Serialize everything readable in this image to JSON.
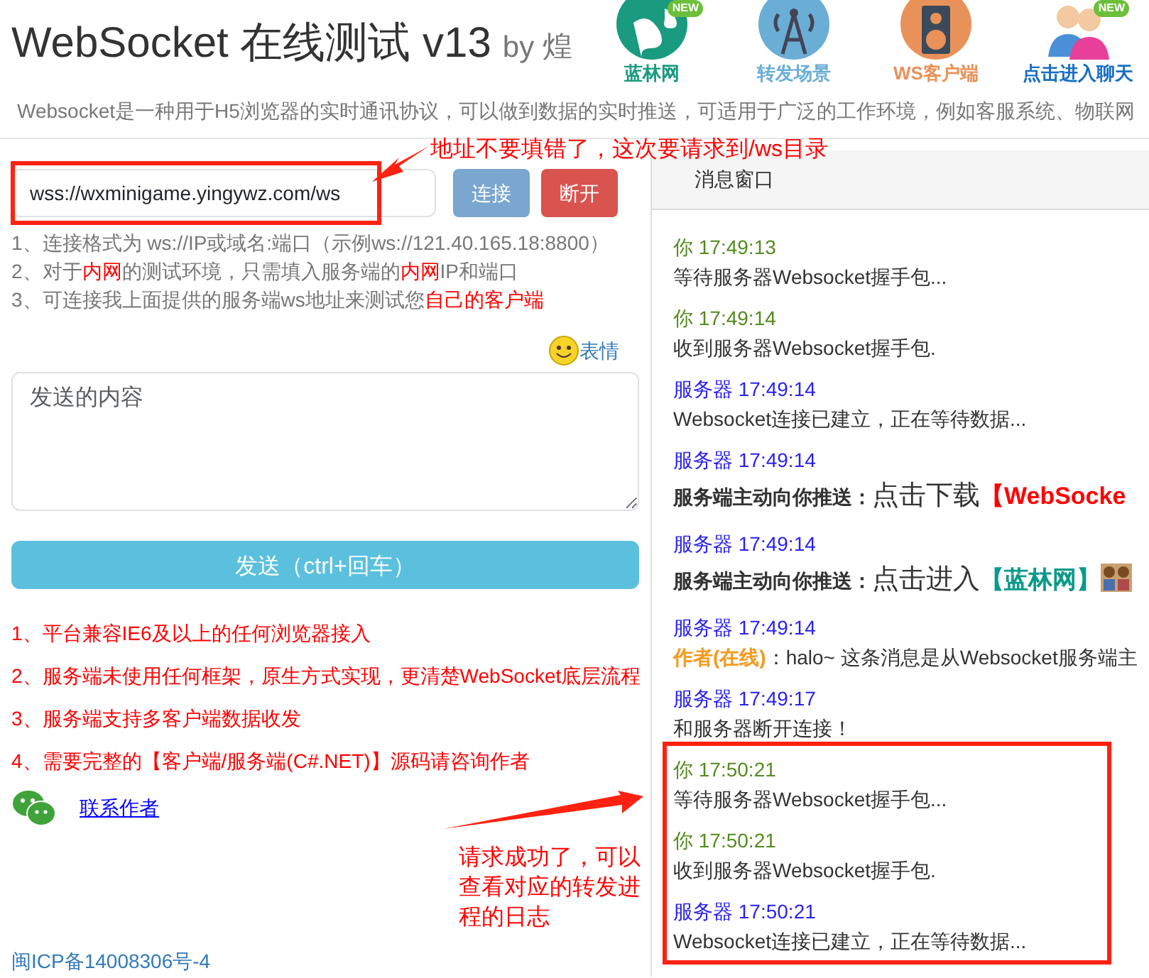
{
  "header": {
    "title": "WebSocket 在线测试 v13",
    "byline": "by 煌",
    "nav": [
      {
        "label": "蓝林网",
        "kind": "globe",
        "color": "#1a9a7f",
        "badge": "NEW"
      },
      {
        "label": "转发场景",
        "kind": "antenna",
        "color": "#6aaed6"
      },
      {
        "label": "WS客户端",
        "kind": "speaker",
        "color": "#e8925a"
      },
      {
        "label": "点击进入聊天",
        "kind": "people",
        "color": "#1a6fc2",
        "badge": "NEW"
      }
    ],
    "description": "Websocket是一种用于H5浏览器的实时通讯协议，可以做到数据的实时推送，可适用于广泛的工作环境，例如客服系统、物联网"
  },
  "connection": {
    "address": "wss://wxminigame.yingywz.com/ws",
    "buttons": [
      {
        "label": "连接",
        "kind": "connect"
      },
      {
        "label": "断开",
        "kind": "disconnect"
      }
    ]
  },
  "hints": [
    [
      {
        "text": "1、连接格式为 ws://IP或域名:端口（示例ws://121.40.165.18:8800）",
        "red": false
      }
    ],
    [
      {
        "text": "2、对于",
        "red": false
      },
      {
        "text": "内网",
        "red": true
      },
      {
        "text": "的测试环境，只需填入服务端的",
        "red": false
      },
      {
        "text": "内网",
        "red": true
      },
      {
        "text": "IP和端口",
        "red": false
      }
    ],
    [
      {
        "text": "3、可连接我上面提供的服务端ws地址来测试您",
        "red": false
      },
      {
        "text": "自己的客户端",
        "red": true
      }
    ]
  ],
  "emoji_link": "表情",
  "message_input": {
    "placeholder": "发送的内容"
  },
  "send_button": "发送（ctrl+回车）",
  "features": [
    "1、平台兼容IE6及以上的任何浏览器接入",
    "2、服务端未使用任何框架，原生方式实现，更清楚WebSocket底层流程",
    "3、服务端支持多客户端数据收发",
    "4、需要完整的【客户端/服务端(C#.NET)】源码请咨询作者"
  ],
  "contact_link": "联系作者",
  "footer": "闽ICP备14008306号-4",
  "message_panel": {
    "title": "消息窗口",
    "messages": [
      {
        "sender": "你",
        "kind": "you",
        "time": "17:49:13",
        "body": [
          {
            "kind": "plain",
            "text": "等待服务器Websocket握手包..."
          }
        ]
      },
      {
        "sender": "你",
        "kind": "you",
        "time": "17:49:14",
        "body": [
          {
            "kind": "plain",
            "text": "收到服务器Websocket握手包."
          }
        ]
      },
      {
        "sender": "服务器",
        "kind": "server",
        "time": "17:49:14",
        "body": [
          {
            "kind": "plain",
            "text": "Websocket连接已建立，正在等待数据..."
          }
        ]
      },
      {
        "sender": "服务器",
        "kind": "server",
        "time": "17:49:14",
        "body": [
          {
            "kind": "bold",
            "text": "服务端主动向你推送："
          },
          {
            "kind": "large",
            "text": "点击下载"
          },
          {
            "kind": "red-bold",
            "text": "【WebSocke"
          }
        ]
      },
      {
        "sender": "服务器",
        "kind": "server",
        "time": "17:49:14",
        "body": [
          {
            "kind": "bold",
            "text": "服务端主动向你推送："
          },
          {
            "kind": "large",
            "text": "点击进入"
          },
          {
            "kind": "teal-bold",
            "text": "【蓝林网】"
          },
          {
            "kind": "picture"
          }
        ]
      },
      {
        "sender": "服务器",
        "kind": "server",
        "time": "17:49:14",
        "body": [
          {
            "kind": "orange-bold",
            "text": "作者(在线)"
          },
          {
            "kind": "plain",
            "text": "：halo~ 这条消息是从Websocket服务端主"
          }
        ]
      },
      {
        "sender": "服务器",
        "kind": "server",
        "time": "17:49:17",
        "body": [
          {
            "kind": "plain",
            "text": "和服务器断开连接！"
          }
        ]
      },
      {
        "sender": "你",
        "kind": "you",
        "time": "17:50:21",
        "body": [
          {
            "kind": "plain",
            "text": "等待服务器Websocket握手包..."
          }
        ]
      },
      {
        "sender": "你",
        "kind": "you",
        "time": "17:50:21",
        "body": [
          {
            "kind": "plain",
            "text": "收到服务器Websocket握手包."
          }
        ]
      },
      {
        "sender": "服务器",
        "kind": "server",
        "time": "17:50:21",
        "body": [
          {
            "kind": "plain",
            "text": "Websocket连接已建立，正在等待数据..."
          }
        ]
      }
    ]
  },
  "annotations": [
    {
      "text": "地址不要填错了，这次要请求到/ws目录"
    },
    {
      "text": "请求成功了，可以查看对应的转发进程的日志"
    }
  ]
}
